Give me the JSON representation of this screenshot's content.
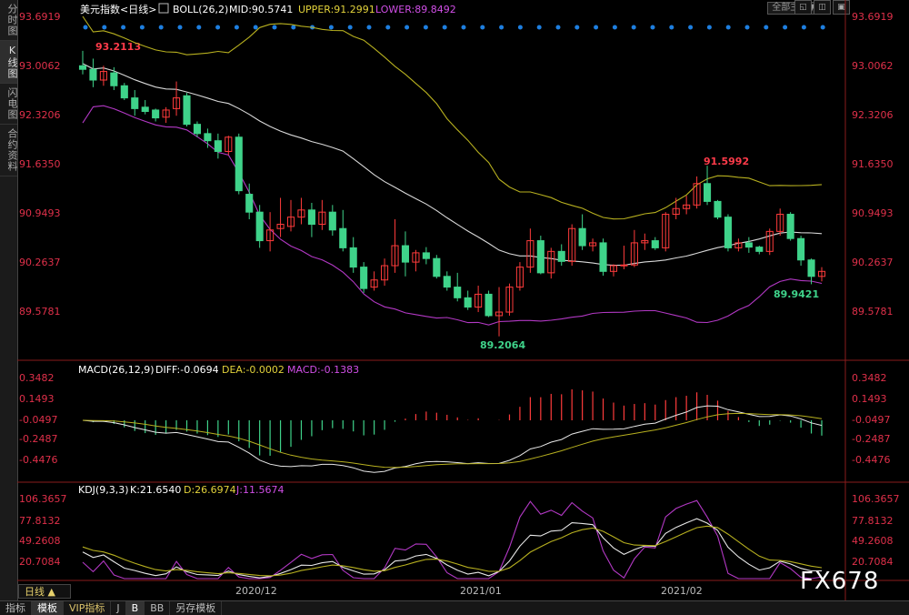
{
  "sidebar": [
    {
      "label": "分时图",
      "active": false
    },
    {
      "label": "K线图",
      "active": true
    },
    {
      "label": "闪电图",
      "active": false
    },
    {
      "label": "合约资料",
      "active": false
    }
  ],
  "topbar": {
    "theme_button": "全部主题▼",
    "win_buttons": [
      "◱",
      "◫",
      "▣"
    ]
  },
  "main": {
    "title": "美元指数<日线>",
    "boll_label": "BOLL(26,2)",
    "boll_mid": "MID:90.5741",
    "boll_upper": "UPPER:91.2991",
    "boll_lower": "LOWER:89.8492",
    "y_ticks": [
      "93.6919",
      "93.0062",
      "92.3206",
      "91.6350",
      "90.9493",
      "90.2637",
      "89.5781"
    ],
    "high_label": "93.2113",
    "low_label": "89.2064",
    "local_high_label": "91.5992",
    "local_low_label": "89.9421"
  },
  "macd": {
    "label": "MACD(26,12,9)",
    "diff": "DIFF:-0.0694",
    "dea": "DEA:-0.0002",
    "macd": "MACD:-0.1383",
    "y_ticks": [
      "0.3482",
      "0.1493",
      "-0.0497",
      "-0.2487",
      "-0.4476"
    ]
  },
  "kdj": {
    "label": "KDJ(9,3,3)",
    "k": "K:21.6540",
    "d": "D:26.6974",
    "j": "J:11.5674",
    "y_ticks": [
      "106.3657",
      "77.8132",
      "49.2608",
      "20.7084"
    ]
  },
  "x_ticks": [
    "2020/12",
    "2021/01",
    "2021/02"
  ],
  "period_button": "日线 ▲",
  "bottom_tabs": [
    "指标",
    "模板",
    "VIP指标",
    "J",
    "B",
    "BB",
    "另存模板"
  ],
  "watermark": "FX678",
  "colors": {
    "up": "#ff3b3b",
    "down": "#3fd38a",
    "mid": "#d8d8d8",
    "upper": "#b7b01f",
    "lower": "#b238c4",
    "axis_text": "#e0304a",
    "grid": "#8a1c1c"
  },
  "chart_data": {
    "type": "candlestick",
    "title": "美元指数<日线>",
    "x_ticks": [
      "2020/12",
      "2021/01",
      "2021/02"
    ],
    "ylim": [
      89.2064,
      93.6919
    ],
    "candles": [
      [
        93.0,
        93.21,
        92.88,
        92.95
      ],
      [
        92.95,
        93.1,
        92.7,
        92.8
      ],
      [
        92.8,
        93.0,
        92.72,
        92.92
      ],
      [
        92.9,
        92.98,
        92.66,
        92.72
      ],
      [
        92.72,
        92.76,
        92.52,
        92.55
      ],
      [
        92.55,
        92.66,
        92.3,
        92.4
      ],
      [
        92.42,
        92.52,
        92.32,
        92.36
      ],
      [
        92.38,
        92.4,
        92.22,
        92.27
      ],
      [
        92.28,
        92.42,
        92.2,
        92.38
      ],
      [
        92.4,
        92.78,
        92.3,
        92.55
      ],
      [
        92.58,
        92.62,
        92.15,
        92.18
      ],
      [
        92.18,
        92.22,
        92.0,
        92.05
      ],
      [
        92.05,
        92.12,
        91.85,
        91.95
      ],
      [
        91.95,
        92.05,
        91.7,
        91.8
      ],
      [
        91.8,
        92.02,
        91.75,
        92.0
      ],
      [
        92.0,
        92.05,
        91.2,
        91.25
      ],
      [
        91.2,
        91.35,
        90.85,
        90.95
      ],
      [
        90.95,
        91.05,
        90.45,
        90.55
      ],
      [
        90.55,
        90.95,
        90.4,
        90.7
      ],
      [
        90.72,
        91.15,
        90.6,
        90.78
      ],
      [
        90.75,
        91.12,
        90.68,
        90.88
      ],
      [
        90.88,
        91.15,
        90.78,
        90.98
      ],
      [
        90.98,
        91.08,
        90.6,
        90.78
      ],
      [
        90.78,
        91.12,
        90.7,
        90.95
      ],
      [
        90.95,
        91.05,
        90.62,
        90.7
      ],
      [
        90.72,
        90.98,
        90.4,
        90.45
      ],
      [
        90.45,
        90.6,
        90.1,
        90.18
      ],
      [
        90.18,
        90.25,
        89.82,
        89.88
      ],
      [
        89.9,
        90.12,
        89.85,
        90.0
      ],
      [
        90.0,
        90.3,
        89.92,
        90.2
      ],
      [
        90.2,
        90.85,
        90.1,
        90.48
      ],
      [
        90.48,
        90.68,
        90.05,
        90.25
      ],
      [
        90.25,
        90.42,
        90.12,
        90.38
      ],
      [
        90.38,
        90.46,
        90.22,
        90.3
      ],
      [
        90.3,
        90.35,
        90.02,
        90.05
      ],
      [
        90.05,
        90.12,
        89.85,
        89.9
      ],
      [
        89.9,
        90.1,
        89.7,
        89.75
      ],
      [
        89.75,
        89.85,
        89.58,
        89.62
      ],
      [
        89.62,
        89.92,
        89.55,
        89.8
      ],
      [
        89.8,
        89.85,
        89.48,
        89.5
      ],
      [
        89.5,
        89.9,
        89.21,
        89.55
      ],
      [
        89.55,
        89.95,
        89.5,
        89.9
      ],
      [
        89.9,
        90.25,
        89.85,
        90.18
      ],
      [
        90.18,
        90.72,
        90.1,
        90.55
      ],
      [
        90.55,
        90.62,
        90.08,
        90.1
      ],
      [
        90.1,
        90.45,
        90.02,
        90.4
      ],
      [
        90.4,
        90.5,
        90.2,
        90.26
      ],
      [
        90.26,
        90.78,
        90.2,
        90.72
      ],
      [
        90.72,
        90.92,
        90.42,
        90.48
      ],
      [
        90.48,
        90.58,
        90.4,
        90.52
      ],
      [
        90.52,
        90.58,
        90.06,
        90.12
      ],
      [
        90.12,
        90.22,
        90.05,
        90.2
      ],
      [
        90.2,
        90.48,
        90.15,
        90.21
      ],
      [
        90.21,
        90.7,
        90.18,
        90.52
      ],
      [
        90.52,
        90.65,
        90.42,
        90.55
      ],
      [
        90.55,
        90.6,
        90.42,
        90.45
      ],
      [
        90.45,
        90.95,
        90.4,
        90.92
      ],
      [
        90.92,
        91.15,
        90.85,
        91.0
      ],
      [
        91.0,
        91.18,
        90.92,
        91.05
      ],
      [
        91.05,
        91.45,
        91.0,
        91.35
      ],
      [
        91.35,
        91.6,
        91.05,
        91.1
      ],
      [
        91.1,
        91.12,
        90.85,
        90.88
      ],
      [
        90.88,
        90.92,
        90.4,
        90.45
      ],
      [
        90.45,
        90.58,
        90.4,
        90.52
      ],
      [
        90.52,
        90.6,
        90.38,
        90.46
      ],
      [
        90.46,
        90.48,
        90.36,
        90.4
      ],
      [
        90.4,
        90.72,
        90.35,
        90.68
      ],
      [
        90.68,
        91.0,
        90.62,
        90.92
      ],
      [
        90.92,
        90.95,
        90.55,
        90.58
      ],
      [
        90.58,
        90.62,
        90.2,
        90.28
      ],
      [
        90.28,
        90.3,
        89.94,
        90.05
      ],
      [
        90.05,
        90.18,
        89.98,
        90.12
      ]
    ]
  }
}
